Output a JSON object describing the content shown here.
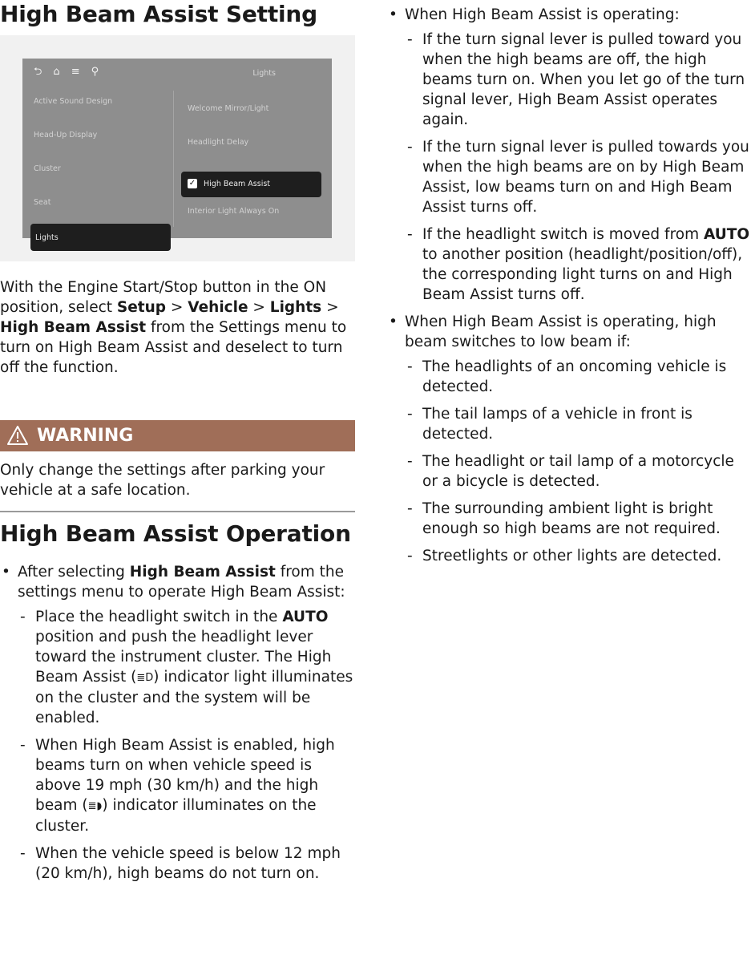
{
  "headings": {
    "setting": "High Beam Assist Setting",
    "operation": "High Beam Assist Operation"
  },
  "screen": {
    "title": "Lights",
    "top_icons": [
      "back-icon",
      "home-icon",
      "menu-icon",
      "search-icon"
    ],
    "left_menu": [
      "Active Sound Design",
      "Head-Up Display",
      "Cluster",
      "Seat",
      "Lights"
    ],
    "right_menu": [
      "Welcome Mirror/Light",
      "Headlight Delay",
      "High Beam Assist",
      "Interior Light Always On"
    ],
    "check_mark": "✓"
  },
  "intro": {
    "t1": "With the Engine Start/Stop button in the ON position, select ",
    "setup": "Setup",
    "sep": " > ",
    "vehicle": "Vehicle",
    "lights": "Lights",
    "hba": "High Beam Assist",
    "t2": " from the Settings menu to turn on High Beam Assist and deselect to turn off the function."
  },
  "warning": {
    "title": "WARNING",
    "text": "Only change the settings after parking your vehicle at a safe location."
  },
  "operation": {
    "b1_pre": "After selecting ",
    "b1_bold": "High Beam Assist",
    "b1_post": " from the settings menu to operate High Beam Assist:",
    "d1_pre": "Place the headlight switch in the ",
    "d1_bold": "AUTO",
    "d1_mid": " position and push the headlight lever toward the instrument cluster. The High Beam Assist (",
    "d1_icon": "≣D",
    "d1_post": ") indicator light illuminates on the cluster and the system will be enabled.",
    "d2_pre": "When High Beam Assist is enabled, high beams turn on when vehicle speed is above 19 mph (30 km/h) and the high beam (",
    "d2_icon": "≣◗",
    "d2_post": ") indicator illuminates on the cluster.",
    "d3": "When the vehicle speed is below 12 mph (20 km/h), high beams do not turn on.",
    "b2": "When High Beam Assist is operating:",
    "d4": "If the turn signal lever is pulled toward you when the high beams are off, the high beams turn on. When you let go of the turn signal lever, High Beam Assist operates again.",
    "d5": "If the turn signal lever is pulled towards you when the high beams are on by High Beam Assist, low beams turn on and High Beam Assist turns off.",
    "d6_pre": "If the headlight switch is moved from ",
    "d6_bold": "AUTO",
    "d6_post": " to another position (headlight/position/off), the corresponding light turns on and High Beam Assist turns off.",
    "b3": "When High Beam Assist is operating, high beam switches to low beam if:",
    "d7": "The headlights of an oncoming vehicle is detected.",
    "d8": "The tail lamps of a vehicle in front is detected.",
    "d9": "The headlight or tail lamp of a motorcycle or a bicycle is detected.",
    "d10": "The surrounding ambient light is bright enough so high beams are not required.",
    "d11": "Streetlights or other lights are detected."
  },
  "glyphs": {
    "bullet": "•",
    "dash": "-"
  }
}
